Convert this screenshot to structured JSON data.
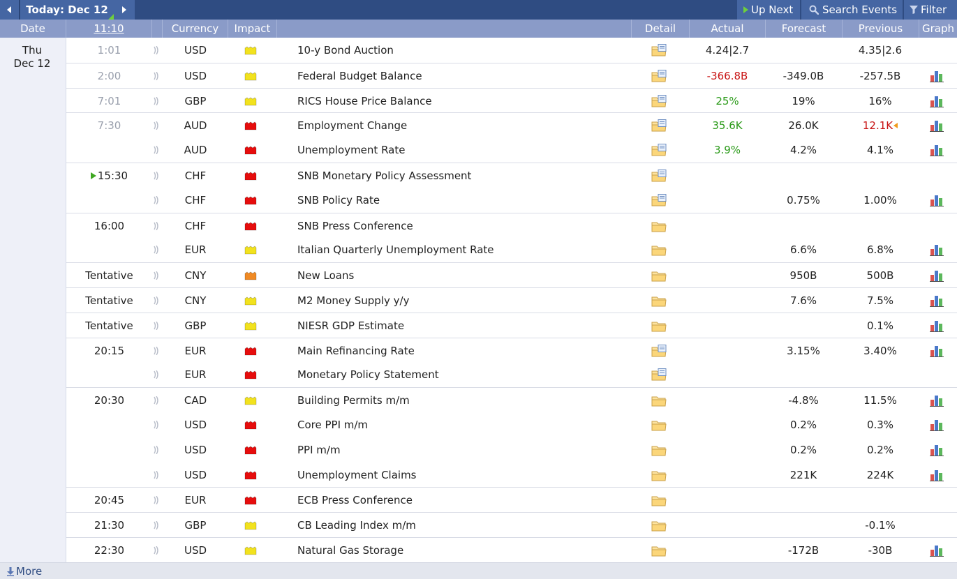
{
  "toolbar": {
    "today_label": "Today: Dec 12",
    "up_next_label": "Up Next",
    "search_label": "Search Events",
    "filter_label": "Filter"
  },
  "columns": {
    "date": "Date",
    "clock": "11:10",
    "currency": "Currency",
    "impact": "Impact",
    "detail": "Detail",
    "actual": "Actual",
    "forecast": "Forecast",
    "previous": "Previous",
    "graph": "Graph"
  },
  "date_group": {
    "weekday": "Thu",
    "date": "Dec 12"
  },
  "colors": {
    "impact_high": "#e60d0d",
    "impact_medium": "#f08a24",
    "impact_low": "#f2e21e",
    "actual_better": "#2a9a18",
    "actual_worse": "#c81414"
  },
  "events": [
    {
      "time": "1:01",
      "time_state": "past",
      "currency": "USD",
      "impact": "low",
      "name": "10-y Bond Auction",
      "actual": "4.24|2.7",
      "actual_state": "",
      "forecast": "",
      "previous": "4.35|2.6",
      "previous_state": "",
      "detail_icon": "folder-detail-icon",
      "graph": false
    },
    {
      "time": "2:00",
      "time_state": "past",
      "currency": "USD",
      "impact": "low",
      "name": "Federal Budget Balance",
      "actual": "-366.8B",
      "actual_state": "worse",
      "forecast": "-349.0B",
      "previous": "-257.5B",
      "previous_state": "",
      "detail_icon": "folder-detail-icon",
      "graph": true
    },
    {
      "time": "7:01",
      "time_state": "past",
      "currency": "GBP",
      "impact": "low",
      "name": "RICS House Price Balance",
      "actual": "25%",
      "actual_state": "better",
      "forecast": "19%",
      "previous": "16%",
      "previous_state": "",
      "detail_icon": "folder-detail-icon",
      "graph": true
    },
    {
      "time": "7:30",
      "time_state": "past",
      "currency": "AUD",
      "impact": "high",
      "name": "Employment Change",
      "actual": "35.6K",
      "actual_state": "better",
      "forecast": "26.0K",
      "previous": "12.1K",
      "previous_state": "revised-worse",
      "detail_icon": "folder-detail-icon",
      "graph": true
    },
    {
      "time": "",
      "time_state": "",
      "currency": "AUD",
      "impact": "high",
      "name": "Unemployment Rate",
      "actual": "3.9%",
      "actual_state": "better",
      "forecast": "4.2%",
      "previous": "4.1%",
      "previous_state": "",
      "detail_icon": "folder-detail-icon",
      "graph": true
    },
    {
      "time": "15:30",
      "time_state": "next",
      "currency": "CHF",
      "impact": "high",
      "name": "SNB Monetary Policy Assessment",
      "actual": "",
      "actual_state": "",
      "forecast": "",
      "previous": "",
      "previous_state": "",
      "detail_icon": "folder-detail-icon",
      "graph": false
    },
    {
      "time": "",
      "time_state": "",
      "currency": "CHF",
      "impact": "high",
      "name": "SNB Policy Rate",
      "actual": "",
      "actual_state": "",
      "forecast": "0.75%",
      "previous": "1.00%",
      "previous_state": "",
      "detail_icon": "folder-detail-icon",
      "graph": true
    },
    {
      "time": "16:00",
      "time_state": "upcoming",
      "currency": "CHF",
      "impact": "high",
      "name": "SNB Press Conference",
      "actual": "",
      "actual_state": "",
      "forecast": "",
      "previous": "",
      "previous_state": "",
      "detail_icon": "folder-icon",
      "graph": false
    },
    {
      "time": "",
      "time_state": "",
      "currency": "EUR",
      "impact": "low",
      "name": "Italian Quarterly Unemployment Rate",
      "actual": "",
      "actual_state": "",
      "forecast": "6.6%",
      "previous": "6.8%",
      "previous_state": "",
      "detail_icon": "folder-icon",
      "graph": true
    },
    {
      "time": "Tentative",
      "time_state": "upcoming",
      "currency": "CNY",
      "impact": "medium",
      "name": "New Loans",
      "actual": "",
      "actual_state": "",
      "forecast": "950B",
      "previous": "500B",
      "previous_state": "",
      "detail_icon": "folder-icon",
      "graph": true
    },
    {
      "time": "Tentative",
      "time_state": "upcoming",
      "currency": "CNY",
      "impact": "low",
      "name": "M2 Money Supply y/y",
      "actual": "",
      "actual_state": "",
      "forecast": "7.6%",
      "previous": "7.5%",
      "previous_state": "",
      "detail_icon": "folder-icon",
      "graph": true
    },
    {
      "time": "Tentative",
      "time_state": "upcoming",
      "currency": "GBP",
      "impact": "low",
      "name": "NIESR GDP Estimate",
      "actual": "",
      "actual_state": "",
      "forecast": "",
      "previous": "0.1%",
      "previous_state": "",
      "detail_icon": "folder-icon",
      "graph": true
    },
    {
      "time": "20:15",
      "time_state": "upcoming",
      "currency": "EUR",
      "impact": "high",
      "name": "Main Refinancing Rate",
      "actual": "",
      "actual_state": "",
      "forecast": "3.15%",
      "previous": "3.40%",
      "previous_state": "",
      "detail_icon": "folder-detail-icon",
      "graph": true
    },
    {
      "time": "",
      "time_state": "",
      "currency": "EUR",
      "impact": "high",
      "name": "Monetary Policy Statement",
      "actual": "",
      "actual_state": "",
      "forecast": "",
      "previous": "",
      "previous_state": "",
      "detail_icon": "folder-detail-icon",
      "graph": false
    },
    {
      "time": "20:30",
      "time_state": "upcoming",
      "currency": "CAD",
      "impact": "low",
      "name": "Building Permits m/m",
      "actual": "",
      "actual_state": "",
      "forecast": "-4.8%",
      "previous": "11.5%",
      "previous_state": "",
      "detail_icon": "folder-icon",
      "graph": true
    },
    {
      "time": "",
      "time_state": "",
      "currency": "USD",
      "impact": "high",
      "name": "Core PPI m/m",
      "actual": "",
      "actual_state": "",
      "forecast": "0.2%",
      "previous": "0.3%",
      "previous_state": "",
      "detail_icon": "folder-icon",
      "graph": true
    },
    {
      "time": "",
      "time_state": "",
      "currency": "USD",
      "impact": "high",
      "name": "PPI m/m",
      "actual": "",
      "actual_state": "",
      "forecast": "0.2%",
      "previous": "0.2%",
      "previous_state": "",
      "detail_icon": "folder-icon",
      "graph": true
    },
    {
      "time": "",
      "time_state": "",
      "currency": "USD",
      "impact": "high",
      "name": "Unemployment Claims",
      "actual": "",
      "actual_state": "",
      "forecast": "221K",
      "previous": "224K",
      "previous_state": "",
      "detail_icon": "folder-icon",
      "graph": true
    },
    {
      "time": "20:45",
      "time_state": "upcoming",
      "currency": "EUR",
      "impact": "high",
      "name": "ECB Press Conference",
      "actual": "",
      "actual_state": "",
      "forecast": "",
      "previous": "",
      "previous_state": "",
      "detail_icon": "folder-icon",
      "graph": false
    },
    {
      "time": "21:30",
      "time_state": "upcoming",
      "currency": "GBP",
      "impact": "low",
      "name": "CB Leading Index m/m",
      "actual": "",
      "actual_state": "",
      "forecast": "",
      "previous": "-0.1%",
      "previous_state": "",
      "detail_icon": "folder-icon",
      "graph": false
    },
    {
      "time": "22:30",
      "time_state": "upcoming",
      "currency": "USD",
      "impact": "low",
      "name": "Natural Gas Storage",
      "actual": "",
      "actual_state": "",
      "forecast": "-172B",
      "previous": "-30B",
      "previous_state": "",
      "detail_icon": "folder-icon",
      "graph": true
    }
  ],
  "footer": {
    "more_label": "More"
  }
}
